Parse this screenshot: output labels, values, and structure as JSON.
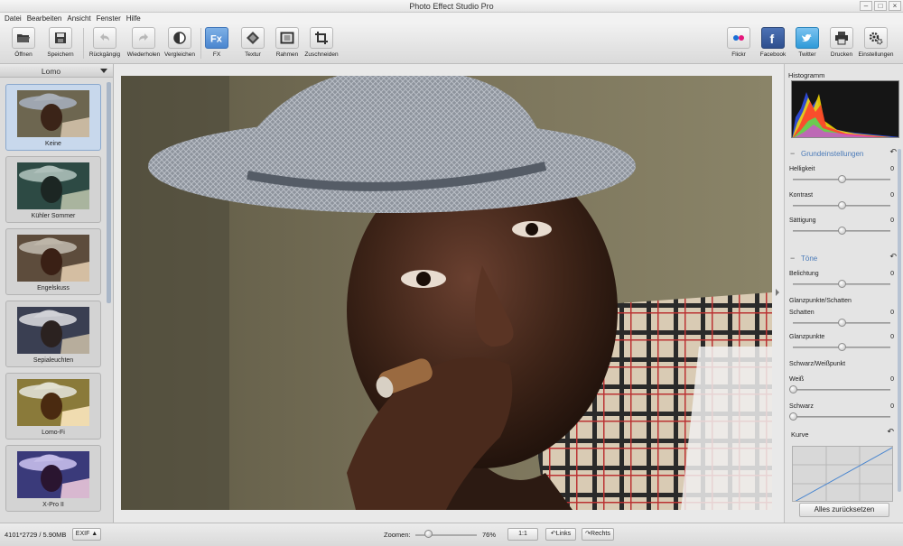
{
  "window": {
    "title": "Photo Effect Studio Pro"
  },
  "menu": [
    "Datei",
    "Bearbeiten",
    "Ansicht",
    "Fenster",
    "Hilfe"
  ],
  "toolbar": {
    "open": "Öffnen",
    "save": "Speichern",
    "undo": "Rückgängig",
    "redo": "Wiederholen",
    "compare": "Vergleichen",
    "fx": "FX",
    "texture": "Textur",
    "frame": "Rahmen",
    "crop": "Zuschneiden",
    "flickr": "Flickr",
    "facebook": "Facebook",
    "twitter": "Twitter",
    "print": "Drucken",
    "settings": "Einstellungen"
  },
  "effects_panel": {
    "category": "Lomo",
    "items": [
      {
        "label": "Keine",
        "selected": true
      },
      {
        "label": "Kühler Sommer"
      },
      {
        "label": "Engelskuss"
      },
      {
        "label": "Sepialeuchten"
      },
      {
        "label": "Lomo-Fi"
      },
      {
        "label": "X-Pro II"
      }
    ]
  },
  "adjust_panel": {
    "histogram_label": "Histogramm",
    "basic": {
      "title": "Grundeinstellungen",
      "brightness": {
        "label": "Helligkeit",
        "value": "0"
      },
      "contrast": {
        "label": "Kontrast",
        "value": "0"
      },
      "saturation": {
        "label": "Sättigung",
        "value": "0"
      }
    },
    "tones": {
      "title": "Töne",
      "exposure": {
        "label": "Belichtung",
        "value": "0"
      },
      "highlights_shadows": "Glanzpunkte/Schatten",
      "shadows": {
        "label": "Schatten",
        "value": "0"
      },
      "highlights": {
        "label": "Glanzpunkte",
        "value": "0"
      },
      "black_white_point": "Schwarz/Weißpunkt",
      "white": {
        "label": "Weiß",
        "value": "0"
      },
      "black": {
        "label": "Schwarz",
        "value": "0"
      }
    },
    "curve_label": "Kurve",
    "reset_all": "Alles zurücksetzen"
  },
  "statusbar": {
    "info": "4101*2729 / 5.90MB",
    "exif": "EXIF ▲",
    "zoom_label": "Zoomen:",
    "zoom_value": "76%",
    "one_to_one": "1:1",
    "rotate_left": "Links",
    "rotate_right": "Rechts"
  },
  "colors": {
    "accent": "#4a86cf",
    "section_title": "#4a7ab8"
  }
}
